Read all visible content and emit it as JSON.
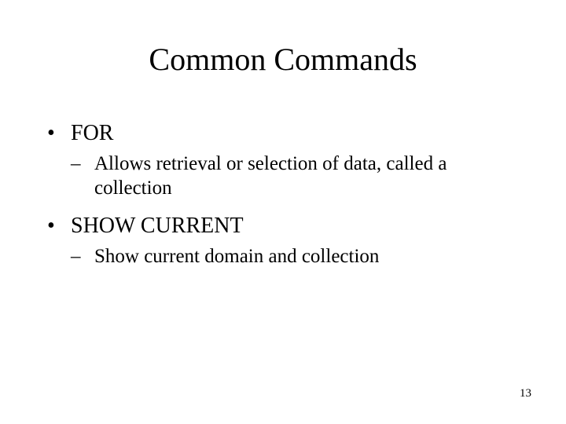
{
  "title": "Common Commands",
  "items": [
    {
      "label": "FOR",
      "sub": [
        "Allows retrieval or selection of data, called a collection"
      ]
    },
    {
      "label": "SHOW CURRENT",
      "sub": [
        "Show current domain and collection"
      ]
    }
  ],
  "page_number": "13"
}
